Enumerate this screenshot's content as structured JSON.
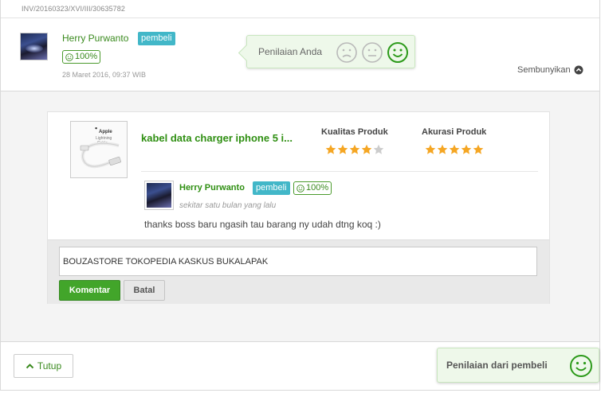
{
  "invoice": {
    "number": "INV/20160323/XVI/III/30635782"
  },
  "buyer": {
    "name": "Herry Purwanto",
    "badge": "pembeli",
    "percent": "100%",
    "date": "28 Maret 2016, 09:37 WIB"
  },
  "rating_prompt": {
    "label": "Penilaian Anda",
    "faces": [
      "sad-face-icon",
      "neutral-face-icon",
      "happy-face-icon"
    ],
    "selected": "happy-face-icon"
  },
  "hide_link": {
    "label": "Sembunyikan"
  },
  "product": {
    "image_text": [
      "Apple",
      "Lightning",
      "Cable"
    ],
    "title": "kabel data charger iphone 5 i...",
    "quality": {
      "label": "Kualitas Produk",
      "stars": 4,
      "max": 5
    },
    "accuracy": {
      "label": "Akurasi Produk",
      "stars": 5,
      "max": 5
    }
  },
  "review": {
    "name": "Herry Purwanto",
    "badge": "pembeli",
    "percent": "100%",
    "time": "sekitar satu bulan yang lalu",
    "text": "thanks boss baru ngasih tau barang ny udah dtng koq :)"
  },
  "reply": {
    "value": "BOUZASTORE TOKOPEDIA KASKUS BUKALAPAK",
    "comment_label": "Komentar",
    "cancel_label": "Batal"
  },
  "footer": {
    "close_label": "Tutup",
    "seller_rating_label": "Penilaian dari pembeli"
  },
  "colors": {
    "accent_green": "#3a8a1e",
    "badge_teal": "#42b7c8",
    "star_gold": "#f5a623",
    "star_empty": "#cccccc"
  }
}
